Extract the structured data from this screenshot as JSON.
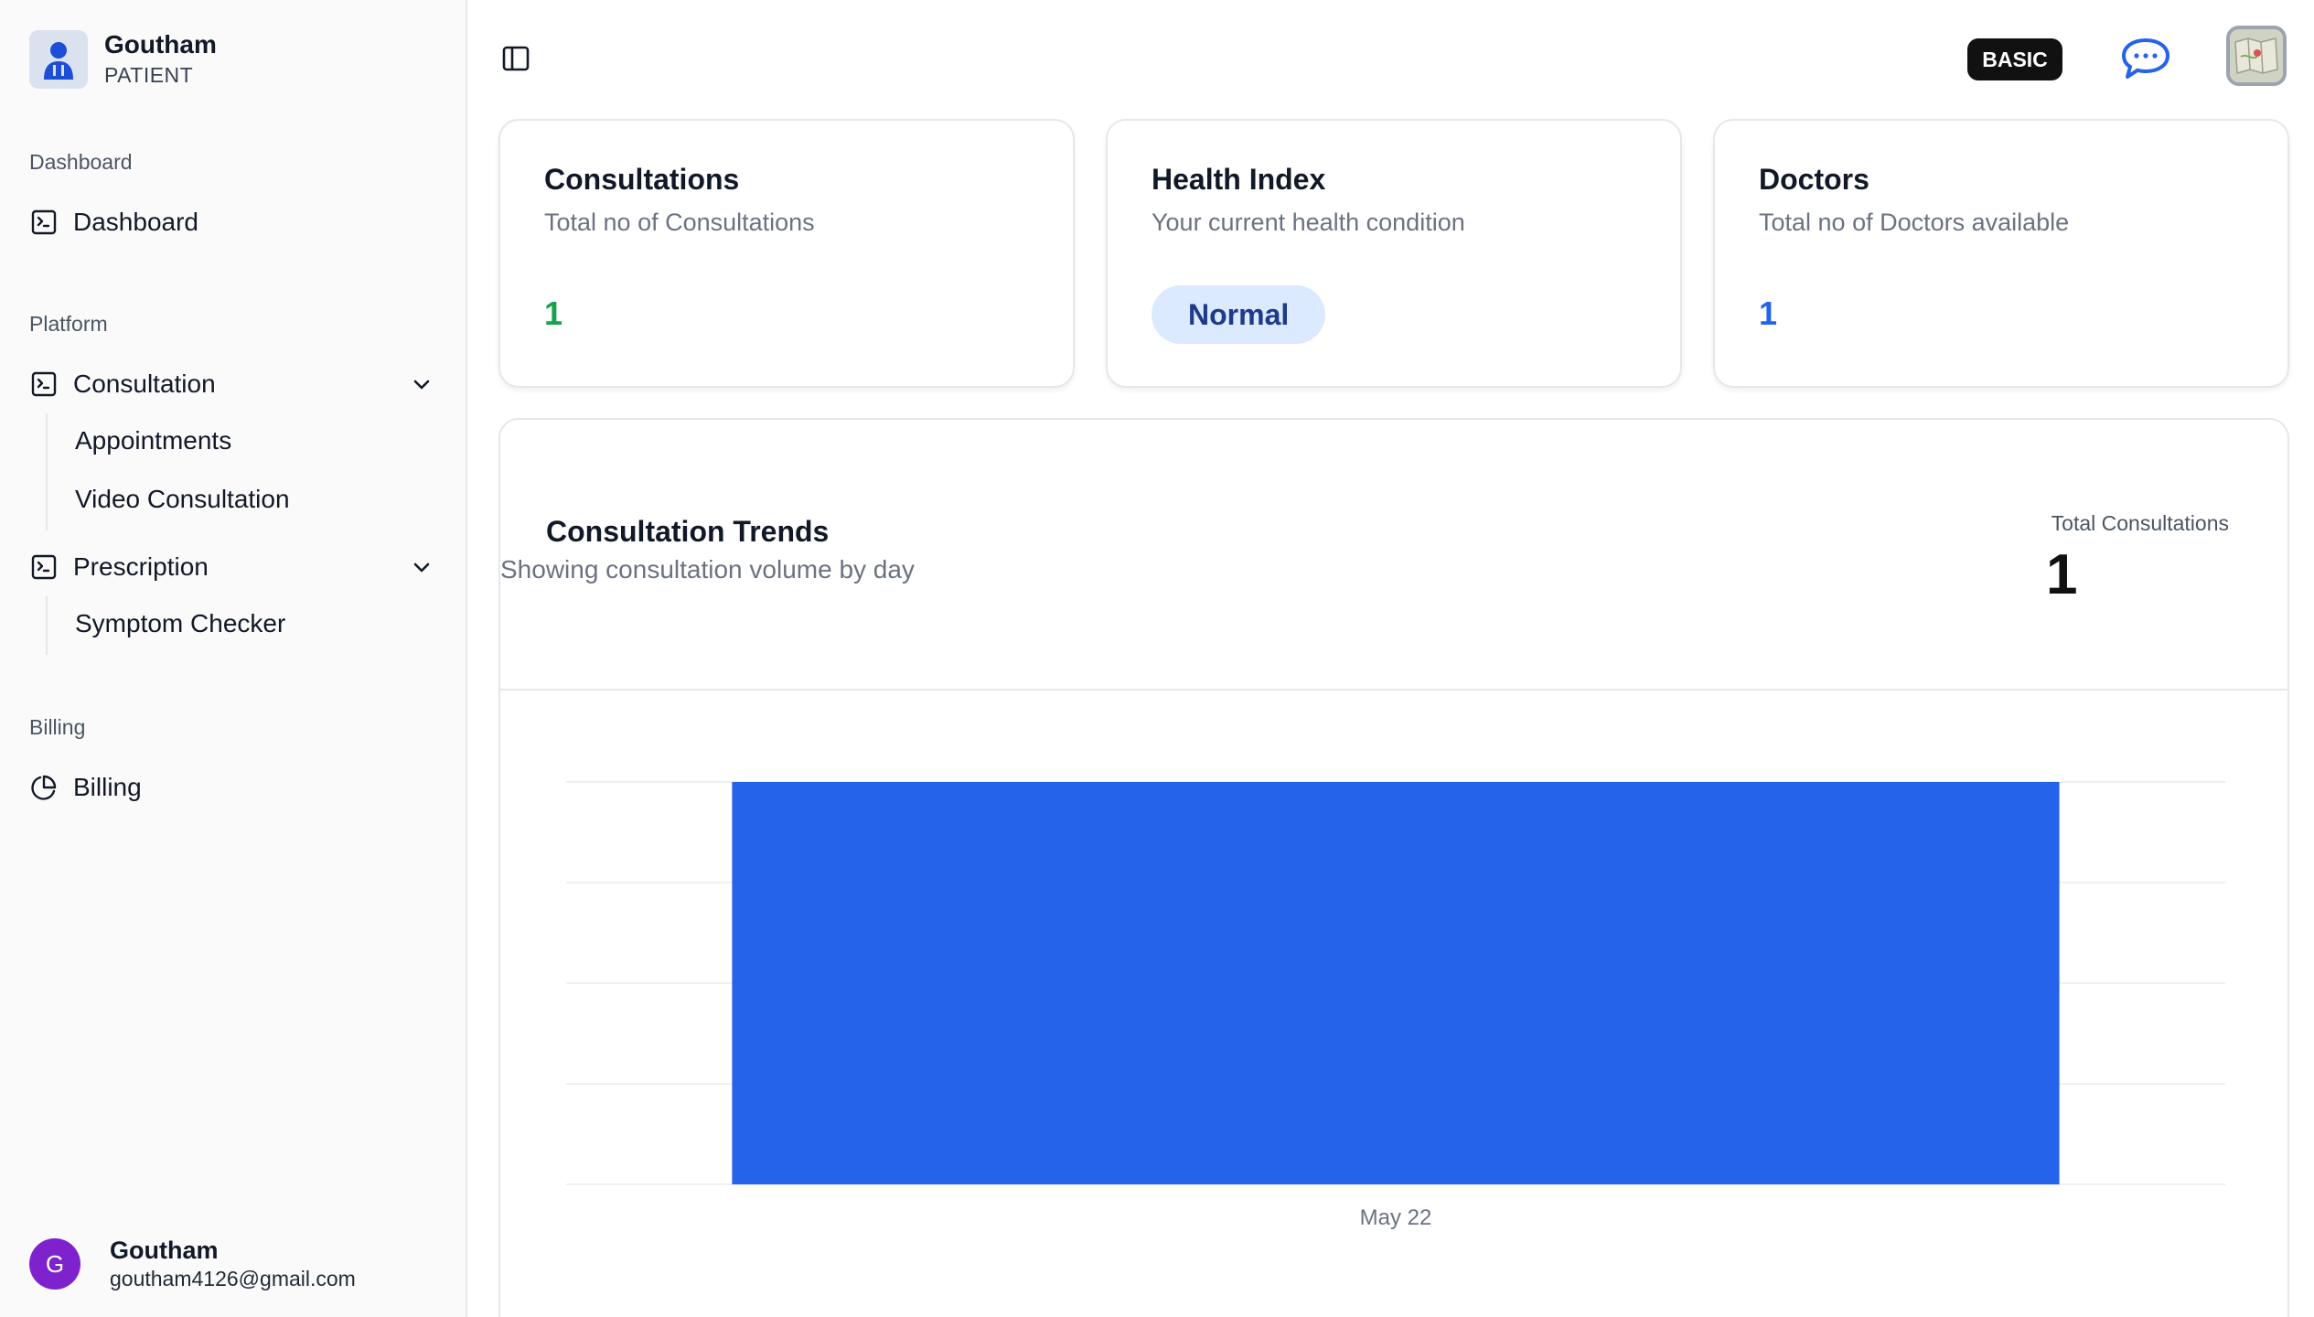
{
  "sidebar": {
    "user": {
      "name": "Goutham",
      "role": "PATIENT"
    },
    "groups": [
      {
        "label": "Dashboard"
      },
      {
        "label": "Platform"
      },
      {
        "label": "Billing"
      }
    ],
    "items": {
      "dashboard": "Dashboard",
      "consultation": "Consultation",
      "appointments": "Appointments",
      "video_consultation": "Video Consultation",
      "prescription": "Prescription",
      "symptom_checker": "Symptom Checker",
      "billing": "Billing"
    },
    "footer": {
      "initial": "G",
      "name": "Goutham",
      "email": "goutham4126@gmail.com"
    }
  },
  "topbar": {
    "plan_badge": "BASIC",
    "icons": [
      "sidebar-toggle-icon",
      "chat-icon",
      "avatar"
    ]
  },
  "cards": [
    {
      "title": "Consultations",
      "subtitle": "Total no of Consultations",
      "value": "1",
      "color": "#16a34a"
    },
    {
      "title": "Health Index",
      "subtitle": "Your current health condition",
      "value": "Normal"
    },
    {
      "title": "Doctors",
      "subtitle": "Total no of Doctors available",
      "value": "1",
      "color": "#2563eb"
    }
  ],
  "trends": {
    "title": "Consultation Trends",
    "subtitle": "Showing consultation volume by day",
    "total_label": "Total Consultations",
    "total_value": "1"
  },
  "chart_data": {
    "type": "bar",
    "categories": [
      "May 22"
    ],
    "values": [
      1
    ],
    "ylim": [
      0,
      1
    ],
    "grid": true,
    "bar_color": "#2563eb"
  }
}
